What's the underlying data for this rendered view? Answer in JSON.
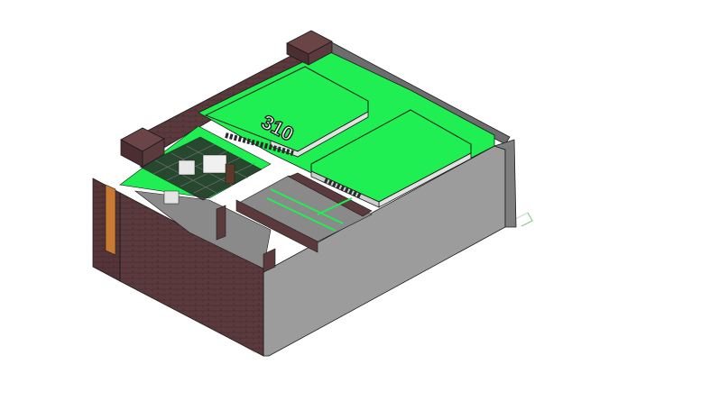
{
  "viewport": {
    "room_number": "310",
    "colors": {
      "background": "#ffffff",
      "highlight_green": "#1fef52",
      "highlight_green_dark": "#15c843",
      "brick": "#5a3a3d",
      "brick_dark": "#3f2629",
      "wall_gray": "#9c9c9c",
      "wall_gray_dark": "#7e7e7e",
      "floor_gray": "#8a8a8a",
      "glass_dark": "#2a2a2a",
      "orange_trim": "#d58a40",
      "outline": "#1b1b1b"
    }
  }
}
